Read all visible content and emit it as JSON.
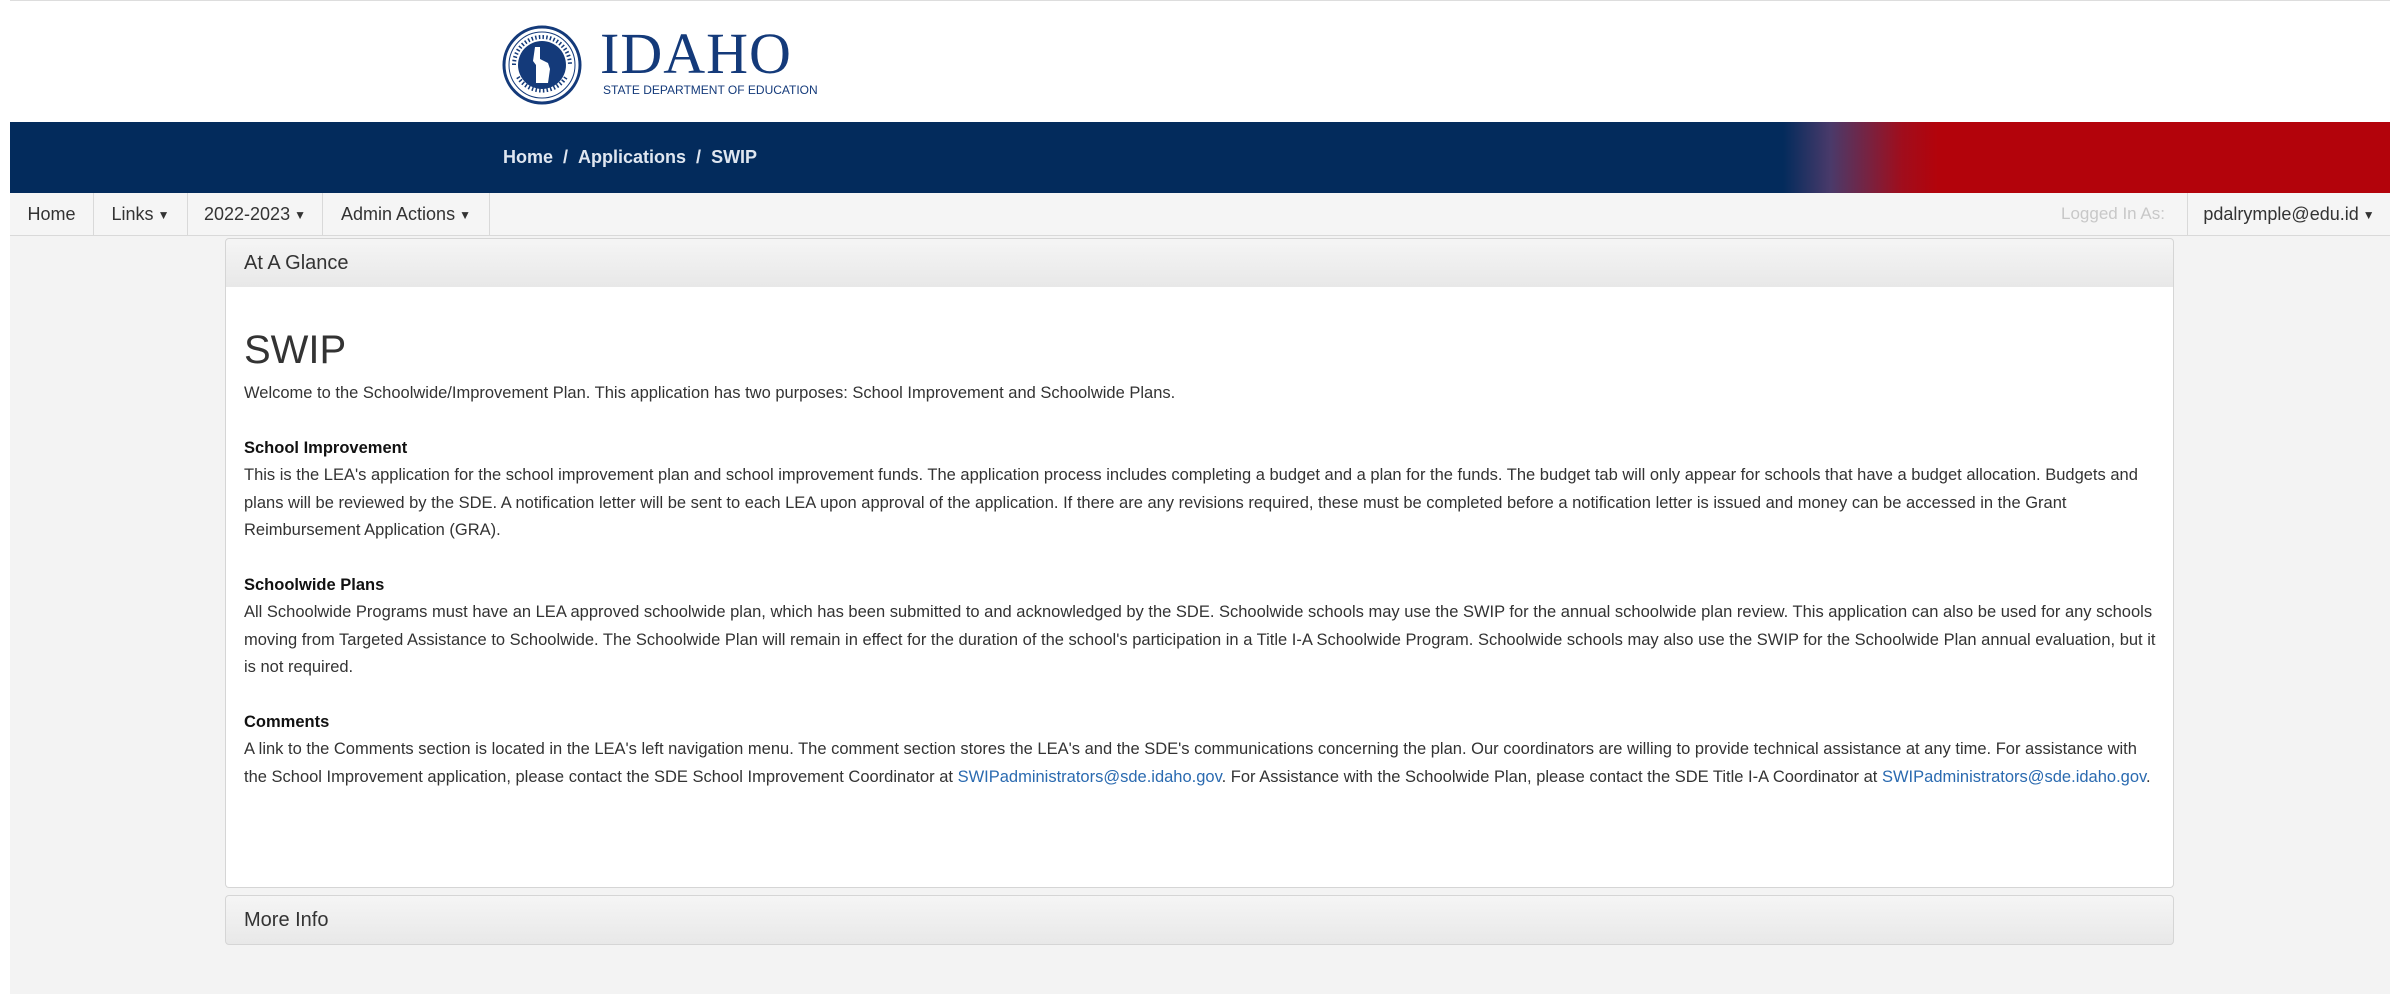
{
  "header": {
    "logo_title": "IDAHO",
    "logo_subtitle": "STATE DEPARTMENT OF EDUCATION",
    "seal_label": "DEPARTMENT OF EDUCATION • STATE OF IDAHO"
  },
  "breadcrumb": {
    "items": [
      "Home",
      "Applications",
      "SWIP"
    ],
    "separator": "/"
  },
  "nav": {
    "home": "Home",
    "links": "Links",
    "year": "2022-2023",
    "admin_actions": "Admin Actions",
    "logged_in_label": "Logged In As:",
    "user": "pdalrymple@edu.id"
  },
  "panels": {
    "at_a_glance": "At A Glance",
    "more_info": "More Info"
  },
  "content": {
    "title": "SWIP",
    "intro": "Welcome to the Schoolwide/Improvement Plan. This application has two purposes: School Improvement and Schoolwide Plans.",
    "sections": [
      {
        "heading": "School Improvement",
        "body": "This is the LEA's application for the school improvement plan and school improvement funds. The application process includes completing a budget and a plan for the funds. The budget tab will only appear for schools that have a budget allocation. Budgets and plans will be reviewed by the SDE. A notification letter will be sent to each LEA upon approval of the application. If there are any revisions required, these must be completed before a notification letter is issued and money can be accessed in the Grant Reimbursement Application (GRA)."
      },
      {
        "heading": "Schoolwide Plans",
        "body": "All Schoolwide Programs must have an LEA approved schoolwide plan, which has been submitted to and acknowledged by the SDE. Schoolwide schools may use the SWIP for the annual schoolwide plan review. This application can also be used for any schools moving from Targeted Assistance to Schoolwide. The Schoolwide Plan will remain in effect for the duration of the school's participation in a Title I-A Schoolwide Program. Schoolwide schools may also use the SWIP for the Schoolwide Plan annual evaluation, but it is not required."
      },
      {
        "heading": "Comments",
        "body_part1": "A link to the Comments section is located in the LEA's left navigation menu. The comment section stores the LEA's and the SDE's communications concerning the plan. Our coordinators are willing to provide technical assistance at any time. For assistance with the School Improvement application, please contact the SDE School Improvement Coordinator at ",
        "email1": "SWIPadministrators@sde.idaho.gov",
        "body_part2": ". For Assistance with the Schoolwide Plan, please contact the SDE Title I-A Coordinator at ",
        "email2": "SWIPadministrators@sde.idaho.gov",
        "body_part3": "."
      }
    ]
  },
  "colors": {
    "banner_blue": "#032b5c",
    "banner_red": "#b3030b",
    "link_blue": "#2a6ab0",
    "logo_blue": "#143a7a"
  }
}
